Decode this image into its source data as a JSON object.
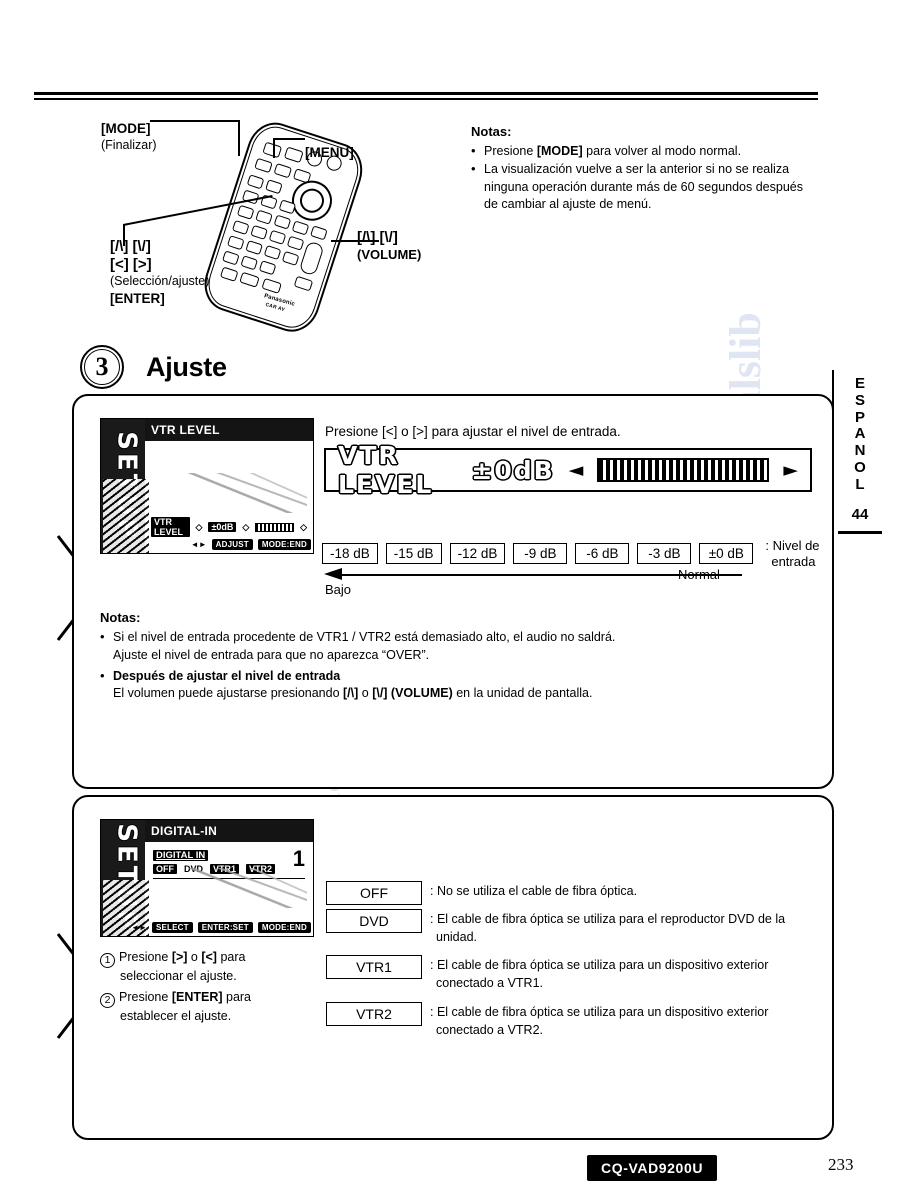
{
  "document": {
    "model": "CQ-VAD9200U",
    "page_number": "233",
    "side_tab_language": "ESPANOL",
    "side_tab_letters": [
      "E",
      "S",
      "P",
      "A",
      "N",
      "O",
      "L"
    ],
    "side_tab_number": "44"
  },
  "remote_labels": {
    "mode": "[MODE]",
    "mode_sub": "(Finalizar)",
    "menu": "[MENU]",
    "volume_keys": "[/\\] [\\/]",
    "volume_sub": "(VOLUME)",
    "nav_line1": "[/\\] [\\/]",
    "nav_line2": "[<] [>]",
    "nav_sub": "(Selección/ajuste)",
    "enter": "[ENTER]",
    "brand": "Panasonic",
    "brand_sub": "CAR AV"
  },
  "notes_top": {
    "title": "Notas:",
    "items": [
      "Presione [MODE] para volver al modo normal.",
      "La visualización vuelve a ser la anterior si no se realiza ninguna operación durante más de 60 segundos después de cambiar al ajuste de menú."
    ],
    "item1_bold": "[MODE]"
  },
  "step": {
    "number": "3",
    "title": "Ajuste"
  },
  "panel1": {
    "screen": {
      "setup_word": "SETUP",
      "title": "VTR LEVEL",
      "status_label": "VTR LEVEL",
      "status_value": "±0dB",
      "foot_adjust": "ADJUST",
      "foot_end": "MODE:END"
    },
    "instruction": "Presione [<] o [>]  para ajustar el nivel de entrada.",
    "lcd_strip": {
      "label": "VTR LEVEL",
      "value": "±0dB",
      "left_arrow": "◄",
      "right_arrow": "►"
    },
    "levels": [
      "-18 dB",
      "-15 dB",
      "-12 dB",
      "-9 dB",
      "-6 dB",
      "-3 dB",
      "±0 dB"
    ],
    "levels_caption_line1": ": Nivel de",
    "levels_caption_line2": "entrada",
    "scale_low": "Bajo",
    "scale_normal": "Normal",
    "notes": {
      "title": "Notas:",
      "items": [
        {
          "line1": "Si el nivel de entrada procedente de VTR1 / VTR2 está demasiado alto, el audio no saldrá.",
          "line2": "Ajuste el nivel de entrada para que no aparezca “OVER”.",
          "bold": false
        },
        {
          "line1": "Después de ajustar el nivel de entrada",
          "line2": "El volumen puede ajustarse presionando [/\\] o [\\/] (VOLUME)  en la unidad de pantalla.",
          "bold": true
        }
      ]
    }
  },
  "panel2": {
    "screen": {
      "setup_word": "SETUP",
      "title": "DIGITAL-IN",
      "row_label": "DIGITAL IN",
      "row_options": [
        "OFF",
        "DVD",
        "VTR1",
        "VTR2"
      ],
      "foot_select": "SELECT",
      "foot_set": "ENTER:SET",
      "foot_end": "MODE:END"
    },
    "instructions": [
      {
        "num": "1",
        "line1": "Presione [>] o [<] para",
        "line2": "seleccionar el ajuste."
      },
      {
        "num": "2",
        "line1": "Presione [ENTER] para",
        "line2": "establecer el ajuste."
      }
    ],
    "options": [
      {
        "label": "OFF",
        "desc_line1": ": No se utiliza el cable de fibra óptica.",
        "desc_line2": ""
      },
      {
        "label": "DVD",
        "desc_line1": ": El cable de fibra óptica se utiliza para el reproductor DVD de la",
        "desc_line2": "unidad."
      },
      {
        "label": "VTR1",
        "desc_line1": ": El cable de fibra óptica se utiliza para un dispositivo exterior",
        "desc_line2": "conectado a VTR1."
      },
      {
        "label": "VTR2",
        "desc_line1": ": El cable de fibra óptica se utiliza para un dispositivo exterior",
        "desc_line2": "conectado a VTR2."
      }
    ]
  }
}
